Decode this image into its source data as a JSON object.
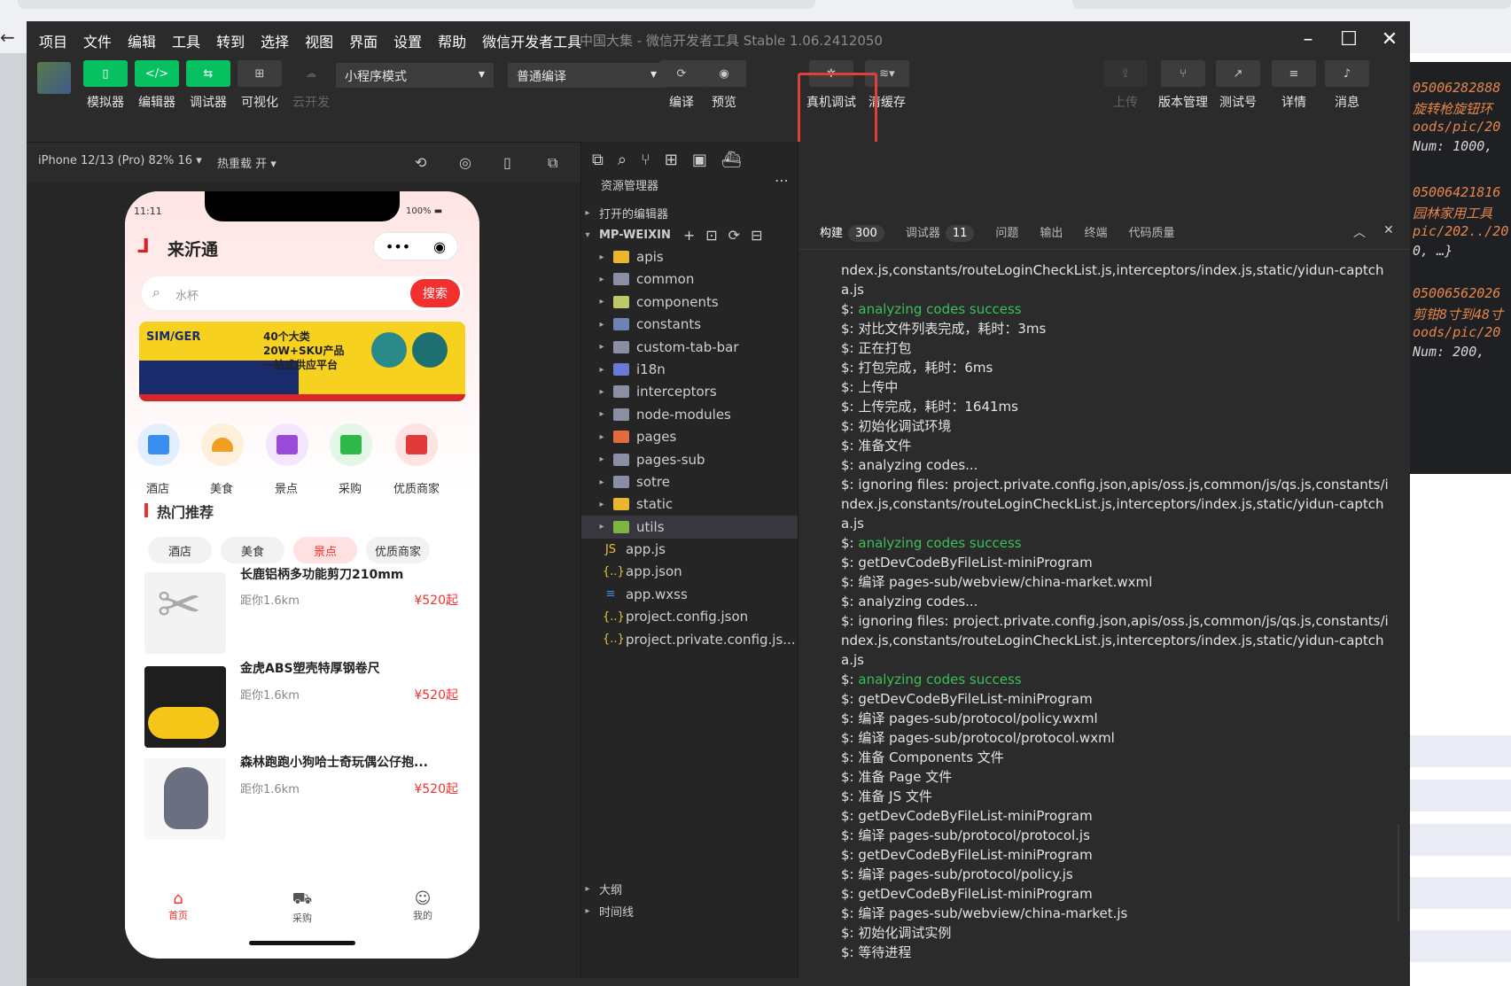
{
  "window": {
    "menu": [
      "项目",
      "文件",
      "编辑",
      "工具",
      "转到",
      "选择",
      "视图",
      "界面",
      "设置",
      "帮助",
      "微信开发者工具"
    ],
    "title": "中国大集 - 微信开发者工具 Stable 1.06.2412050"
  },
  "toolbar": {
    "simulator": "模拟器",
    "editor": "编辑器",
    "debugger": "调试器",
    "visual": "可视化",
    "cloud": "云开发",
    "mode_select": "小程序模式",
    "compile_select": "普通编译",
    "compile": "编译",
    "preview": "预览",
    "remote_debug": "真机调试",
    "clear_cache": "清缓存",
    "upload": "上传",
    "version": "版本管理",
    "test_account": "测试号",
    "details": "详情",
    "messages": "消息"
  },
  "simulator": {
    "device": "iPhone 12/13 (Pro) 82% 16",
    "hotreload": "热重载 开"
  },
  "phone": {
    "time": "11:11",
    "battery": "100%",
    "brand": "来沂通",
    "search_placeholder": "水杯",
    "search_button": "搜索",
    "banner": {
      "brand": "SIM/GER",
      "text1": "40个大类",
      "text2": "20W+SKU产品",
      "text3": "一站式供应平台"
    },
    "categories": [
      "酒店",
      "美食",
      "景点",
      "采购",
      "优质商家"
    ],
    "section_title": "热门推荐",
    "chips": [
      "酒店",
      "美食",
      "景点",
      "优质商家"
    ],
    "products": [
      {
        "title": "长鹿铝柄多功能剪刀210mm",
        "dist": "距你1.6km",
        "price": "¥520起"
      },
      {
        "title": "金虎ABS塑壳特厚钢卷尺",
        "dist": "距你1.6km",
        "price": "¥520起"
      },
      {
        "title": "森林跑跑小狗哈士奇玩偶公仔抱...",
        "dist": "距你1.6km",
        "price": "¥520起"
      }
    ],
    "tabs": [
      "首页",
      "采购",
      "我的"
    ]
  },
  "explorer": {
    "title": "资源管理器",
    "open_editors": "打开的编辑器",
    "project": "MP-WEIXIN",
    "folders": [
      {
        "name": "apis",
        "color": "#e8b72d"
      },
      {
        "name": "common",
        "color": "#8a8fa3"
      },
      {
        "name": "components",
        "color": "#c0c96a"
      },
      {
        "name": "constants",
        "color": "#6e83b5"
      },
      {
        "name": "custom-tab-bar",
        "color": "#8a8fa3"
      },
      {
        "name": "i18n",
        "color": "#6a7bd6"
      },
      {
        "name": "interceptors",
        "color": "#8a8fa3"
      },
      {
        "name": "node-modules",
        "color": "#8a8fa3"
      },
      {
        "name": "pages",
        "color": "#e26c3f"
      },
      {
        "name": "pages-sub",
        "color": "#8a8fa3"
      },
      {
        "name": "sotre",
        "color": "#8a8fa3"
      },
      {
        "name": "static",
        "color": "#e8b72d"
      },
      {
        "name": "utils",
        "color": "#7cb542"
      }
    ],
    "files": [
      {
        "name": "app.js",
        "icon": "JS",
        "color": "#e8c234"
      },
      {
        "name": "app.json",
        "icon": "{..}",
        "color": "#e8c234"
      },
      {
        "name": "app.wxss",
        "icon": "≡",
        "color": "#3a8ee6"
      },
      {
        "name": "project.config.json",
        "icon": "{..}",
        "color": "#e8c234"
      },
      {
        "name": "project.private.config.js...",
        "icon": "{..}",
        "color": "#e8c234"
      }
    ],
    "outline": "大纲",
    "timeline": "时间线"
  },
  "console": {
    "tabs": [
      {
        "label": "构建",
        "badge": "300"
      },
      {
        "label": "调试器",
        "badge": "11"
      },
      {
        "label": "问题",
        "badge": ""
      },
      {
        "label": "输出",
        "badge": ""
      },
      {
        "label": "终端",
        "badge": ""
      },
      {
        "label": "代码质量",
        "badge": ""
      }
    ],
    "lines": [
      {
        "p": "",
        "t": "ndex.js,constants/routeLoginCheckList.js,interceptors/index.js,static/yidun-captch",
        "ok": false
      },
      {
        "p": "",
        "t": "a.js",
        "ok": false
      },
      {
        "p": "$: ",
        "t": "analyzing codes success",
        "ok": true
      },
      {
        "p": "$: ",
        "t": "对比文件列表完成，耗时：3ms",
        "ok": false
      },
      {
        "p": "$: ",
        "t": "正在打包",
        "ok": false
      },
      {
        "p": "$: ",
        "t": "打包完成，耗时：6ms",
        "ok": false
      },
      {
        "p": "$: ",
        "t": "上传中",
        "ok": false
      },
      {
        "p": "$: ",
        "t": "上传完成，耗时：1641ms",
        "ok": false
      },
      {
        "p": "$: ",
        "t": "初始化调试环境",
        "ok": false
      },
      {
        "p": "$: ",
        "t": "准备文件",
        "ok": false
      },
      {
        "p": "$: ",
        "t": "analyzing codes...",
        "ok": false
      },
      {
        "p": "$: ",
        "t": "ignoring files: project.private.config.json,apis/oss.js,common/js/qs.js,constants/i",
        "ok": false
      },
      {
        "p": "",
        "t": "ndex.js,constants/routeLoginCheckList.js,interceptors/index.js,static/yidun-captch",
        "ok": false
      },
      {
        "p": "",
        "t": "a.js",
        "ok": false
      },
      {
        "p": "$: ",
        "t": "analyzing codes success",
        "ok": true
      },
      {
        "p": "$: ",
        "t": "getDevCodeByFileList-miniProgram",
        "ok": false
      },
      {
        "p": "$: ",
        "t": "编译 pages-sub/webview/china-market.wxml",
        "ok": false
      },
      {
        "p": "$: ",
        "t": "analyzing codes...",
        "ok": false
      },
      {
        "p": "$: ",
        "t": "ignoring files: project.private.config.json,apis/oss.js,common/js/qs.js,constants/i",
        "ok": false
      },
      {
        "p": "",
        "t": "ndex.js,constants/routeLoginCheckList.js,interceptors/index.js,static/yidun-captch",
        "ok": false
      },
      {
        "p": "",
        "t": "a.js",
        "ok": false
      },
      {
        "p": "$: ",
        "t": "analyzing codes success",
        "ok": true
      },
      {
        "p": "$: ",
        "t": "getDevCodeByFileList-miniProgram",
        "ok": false
      },
      {
        "p": "$: ",
        "t": "编译 pages-sub/protocol/policy.wxml",
        "ok": false
      },
      {
        "p": "$: ",
        "t": "编译 pages-sub/protocol/protocol.wxml",
        "ok": false
      },
      {
        "p": "$: ",
        "t": "准备 Components 文件",
        "ok": false
      },
      {
        "p": "$: ",
        "t": "准备 Page 文件",
        "ok": false
      },
      {
        "p": "$: ",
        "t": "准备 JS 文件",
        "ok": false
      },
      {
        "p": "$: ",
        "t": "getDevCodeByFileList-miniProgram",
        "ok": false
      },
      {
        "p": "$: ",
        "t": "编译 pages-sub/protocol/protocol.js",
        "ok": false
      },
      {
        "p": "$: ",
        "t": "getDevCodeByFileList-miniProgram",
        "ok": false
      },
      {
        "p": "$: ",
        "t": "编译 pages-sub/protocol/policy.js",
        "ok": false
      },
      {
        "p": "$: ",
        "t": "getDevCodeByFileList-miniProgram",
        "ok": false
      },
      {
        "p": "$: ",
        "t": "编译 pages-sub/webview/china-market.js",
        "ok": false
      },
      {
        "p": "$: ",
        "t": "初始化调试实例",
        "ok": false
      },
      {
        "p": "$: ",
        "t": "等待进程",
        "ok": false
      }
    ]
  },
  "background_code": [
    "05006282888",
    "旋转枪旋钮环",
    "oods/pic/20",
    "Num: 1000,",
    "05006421816",
    "园林家用工具",
    "pic/202../20",
    "0, …}",
    "05006562026",
    "剪钳8寸到48寸",
    "oods/pic/20",
    "Num: 200,"
  ]
}
